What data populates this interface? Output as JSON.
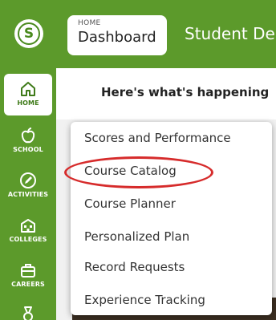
{
  "header": {
    "breadcrumb_small": "HOME",
    "breadcrumb_main": "Dashboard",
    "title": "Student De"
  },
  "content": {
    "heading": "Here's what's happening"
  },
  "sidebar": {
    "items": [
      {
        "label": "HOME",
        "icon": "home-icon",
        "active": true
      },
      {
        "label": "SCHOOL",
        "icon": "apple-icon",
        "active": false
      },
      {
        "label": "ACTIVITIES",
        "icon": "pencil-icon",
        "active": false
      },
      {
        "label": "COLLEGES",
        "icon": "building-icon",
        "active": false
      },
      {
        "label": "CAREERS",
        "icon": "briefcase-icon",
        "active": false
      },
      {
        "label": "",
        "icon": "medal-icon",
        "active": false
      }
    ]
  },
  "dropdown": {
    "items": [
      {
        "label": "Scores and Performance"
      },
      {
        "label": "Course Catalog",
        "highlighted": true
      },
      {
        "label": "Course Planner"
      },
      {
        "label": "Personalized Plan"
      },
      {
        "label": "Record Requests"
      },
      {
        "label": "Experience Tracking"
      }
    ]
  },
  "colors": {
    "brand_green": "#5c9a2b",
    "highlight_red": "#d62b2b"
  }
}
